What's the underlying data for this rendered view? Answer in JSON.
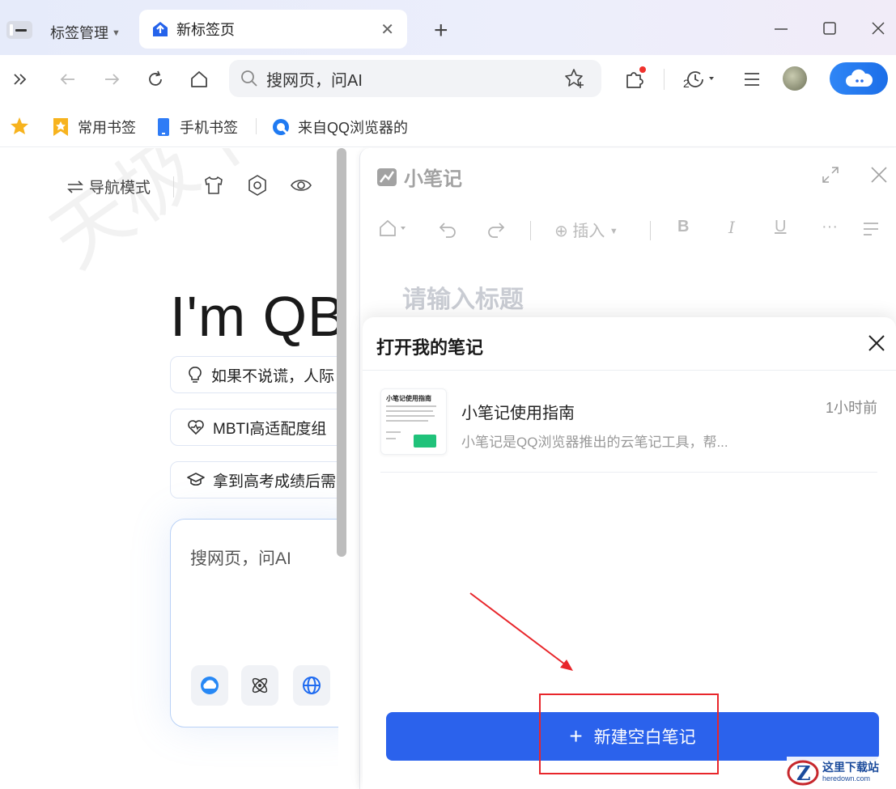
{
  "tabs": {
    "manage_label": "标签管理",
    "active_tab_title": "新标签页"
  },
  "omnibox": {
    "text": "搜网页，问AI"
  },
  "history_badge": "2",
  "bookmarks": [
    {
      "label": "常用书签"
    },
    {
      "label": "手机书签"
    },
    {
      "label": "来自QQ浏览器的"
    }
  ],
  "page": {
    "nav_mode": "导航模式",
    "brand": "I'm QB",
    "watermark": "天极下载站",
    "suggestions": [
      {
        "text": "如果不说谎，人际"
      },
      {
        "text": "MBTI高适配度组"
      },
      {
        "text": "拿到高考成绩后需"
      }
    ],
    "search_placeholder": "搜网页，问AI"
  },
  "note_panel": {
    "title": "小笔记",
    "toolbar_insert": "插入",
    "title_placeholder": "请输入标题",
    "popup": {
      "title": "打开我的笔记",
      "notes": [
        {
          "title": "小笔记使用指南",
          "time": "1小时前",
          "summary": "小笔记是QQ浏览器推出的云笔记工具，帮...",
          "thumb_title": "小笔记使用指南"
        }
      ],
      "new_button_label": "新建空白笔记"
    }
  },
  "watermark_logo": {
    "line1": "这里下载站",
    "line2": "heredown.com"
  },
  "colors": {
    "primary": "#2b62ec",
    "annotation_red": "#e8262b"
  }
}
